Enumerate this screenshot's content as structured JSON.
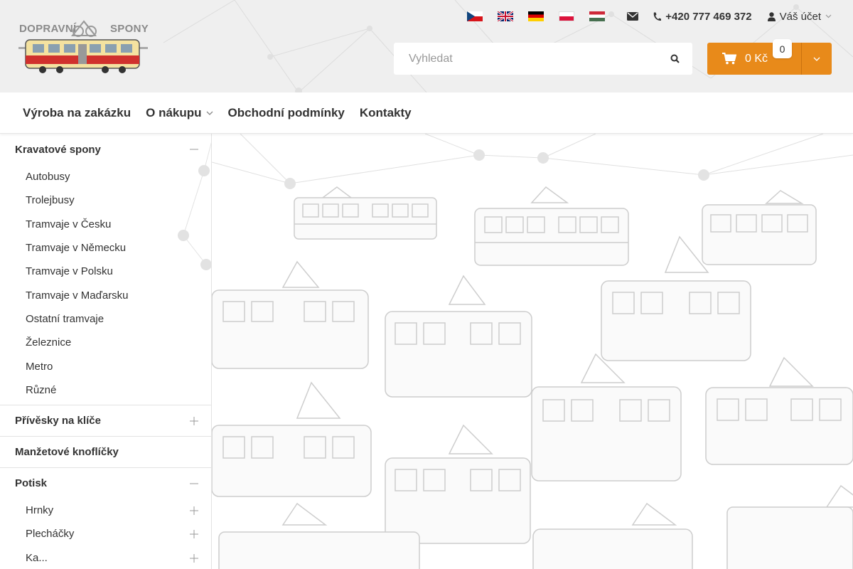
{
  "header": {
    "logo_left": "DOPRAVNÍ",
    "logo_right": "SPONY",
    "languages": [
      {
        "code": "cs",
        "icon": "czech-flag-icon"
      },
      {
        "code": "en",
        "icon": "uk-flag-icon"
      },
      {
        "code": "de",
        "icon": "german-flag-icon"
      },
      {
        "code": "pl",
        "icon": "polish-flag-icon"
      },
      {
        "code": "hu",
        "icon": "hungarian-flag-icon"
      }
    ],
    "phone": "+420 777 469 372",
    "account_label": "Váš účet",
    "search_placeholder": "Vyhledat",
    "cart_total": "0 Kč",
    "cart_count": "0"
  },
  "nav": {
    "items": [
      "Výroba na zakázku",
      "O nákupu",
      "Obchodní podmínky",
      "Kontakty"
    ]
  },
  "sidebar": {
    "cat1": "Kravatové spony",
    "cat1_items": [
      "Autobusy",
      "Trolejbusy",
      "Tramvaje v Česku",
      "Tramvaje v Německu",
      "Tramvaje v Polsku",
      "Tramvaje v Maďarsku",
      "Ostatní tramvaje",
      "Železnice",
      "Metro",
      "Různé"
    ],
    "cat2": "Přívěsky na klíče",
    "cat3": "Manžetové knoflíčky",
    "cat4": "Potisk",
    "cat4_items": [
      "Hrnky",
      "Plecháčky",
      "Ka..."
    ]
  },
  "colors": {
    "accent": "#e88a1a",
    "header_bg": "#efefef",
    "text": "#333333"
  }
}
